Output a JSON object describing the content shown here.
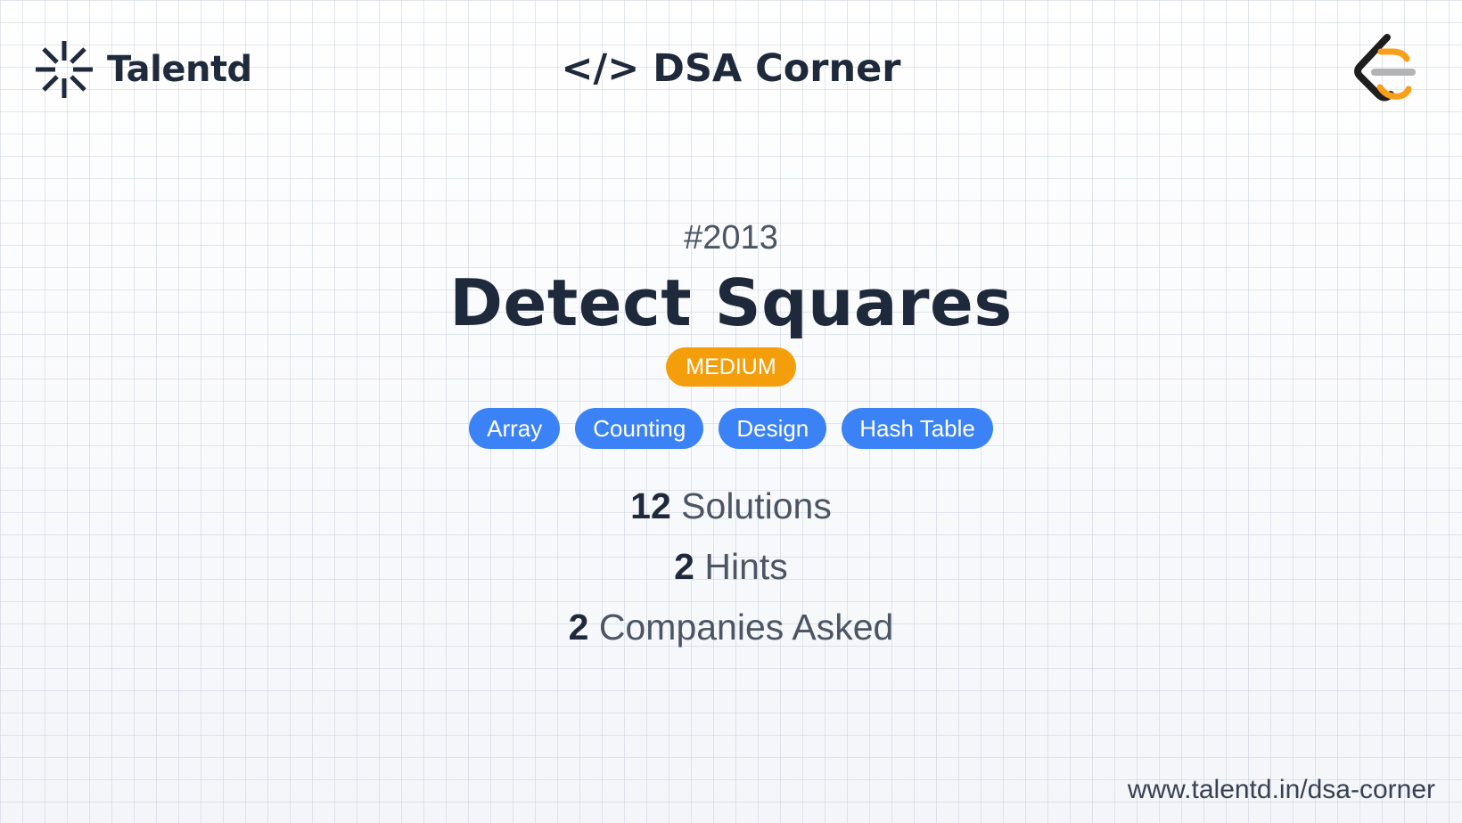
{
  "brand": {
    "name": "Talentd",
    "logo_icon": "asterisk-burst-icon"
  },
  "header": {
    "title": "</> DSA Corner"
  },
  "leetcode_logo_icon": "leetcode-logo-icon",
  "problem": {
    "number": "#2013",
    "title": "Detect Squares",
    "difficulty": "MEDIUM",
    "tags": [
      "Array",
      "Counting",
      "Design",
      "Hash Table"
    ]
  },
  "stats": {
    "solutions_count": "12",
    "solutions_label": "Solutions",
    "hints_count": "2",
    "hints_label": "Hints",
    "companies_count": "2",
    "companies_label": "Companies Asked"
  },
  "footer": {
    "url": "www.talentd.in/dsa-corner"
  },
  "colors": {
    "difficulty_medium": "#f59e0b",
    "tag_blue": "#3b82f6",
    "text_dark": "#1e293b",
    "leetcode_orange": "#f89f1b",
    "leetcode_gray": "#b3b3b3"
  }
}
